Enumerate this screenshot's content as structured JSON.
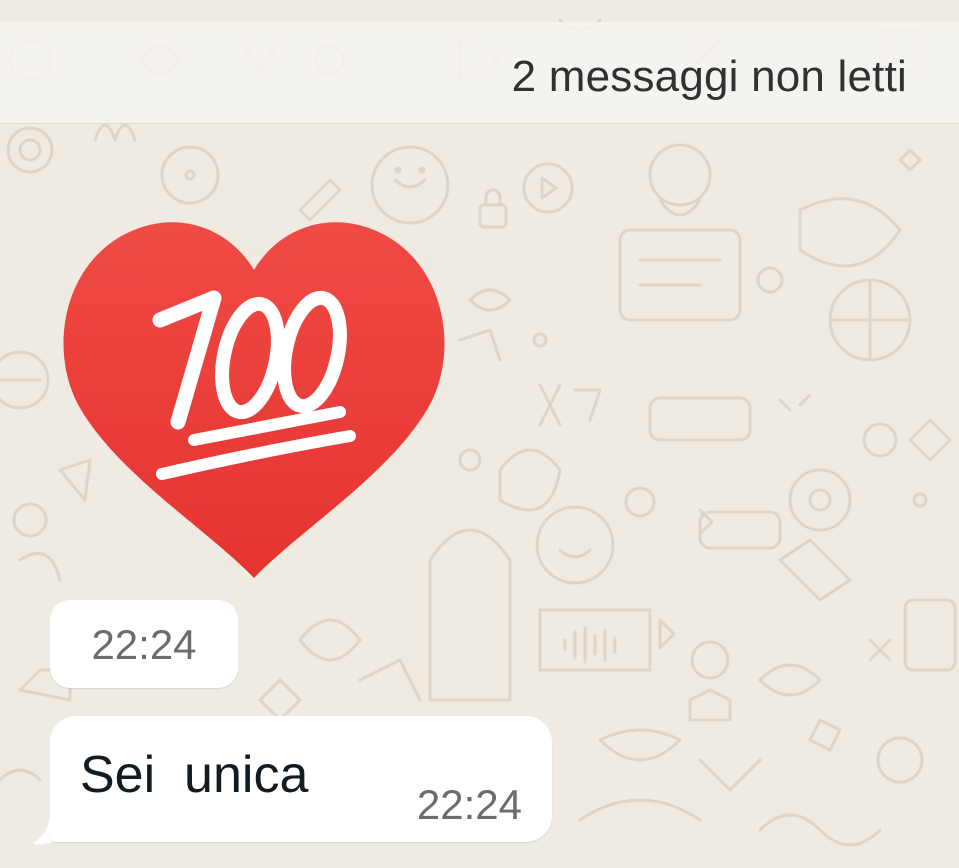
{
  "unread_banner": {
    "text": "2 messaggi non letti"
  },
  "sticker": {
    "icon": "hundred-points-heart-icon",
    "text": "100",
    "heart_color": "#f0433f",
    "text_color": "#ffffff"
  },
  "messages": [
    {
      "kind": "sticker",
      "time": "22:24"
    },
    {
      "kind": "text",
      "text": "Sei  unica",
      "time": "22:24"
    }
  ],
  "colors": {
    "background": "#efeae2",
    "doodle_stroke": "#dcd5c7",
    "bubble": "#ffffff",
    "banner_text": "#2f3133",
    "timestamp": "#6a6d70"
  }
}
